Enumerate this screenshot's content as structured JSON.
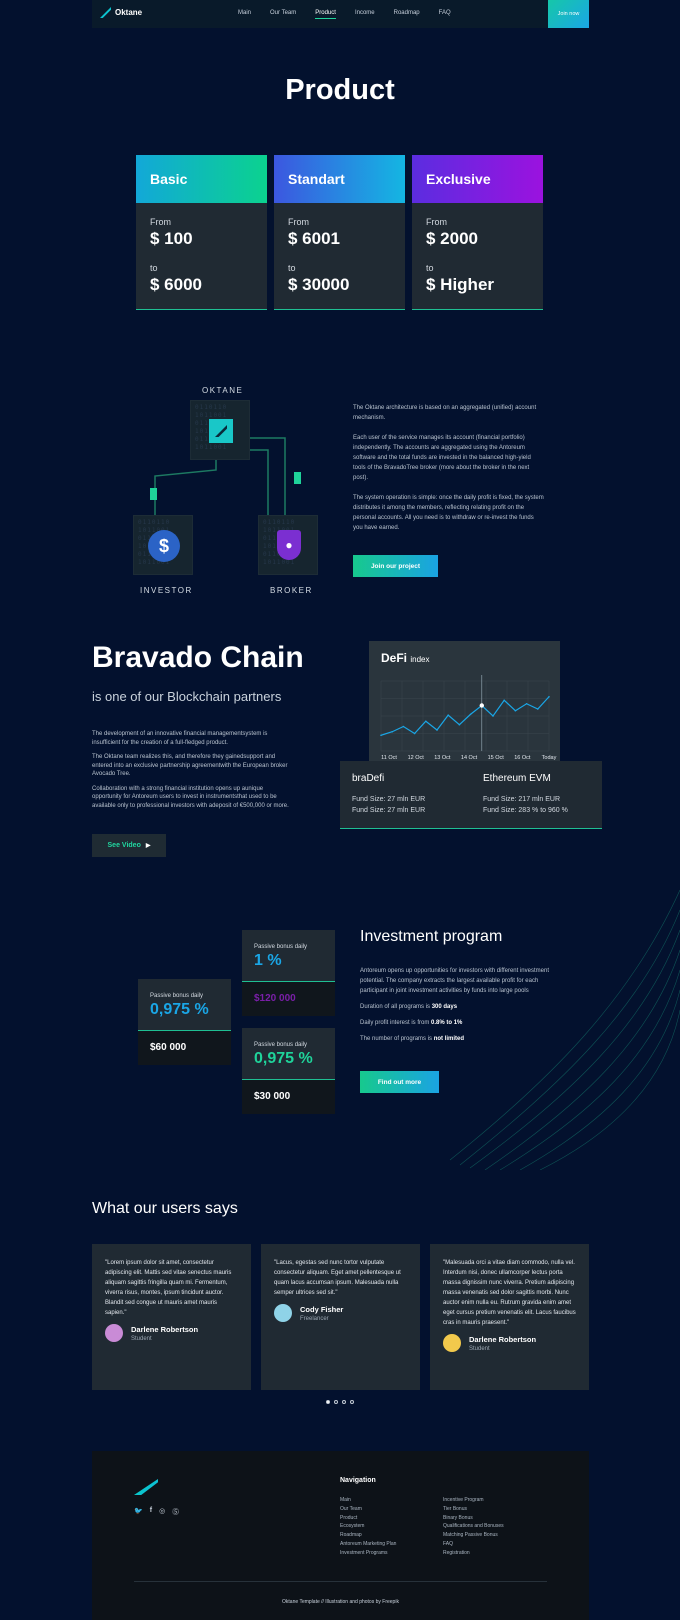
{
  "nav": {
    "brand": "Oktane",
    "links": [
      "Main",
      "Our Team",
      "Product",
      "Income",
      "Roadmap",
      "FAQ"
    ],
    "active": "Product",
    "join_label": "Join now"
  },
  "product": {
    "title": "Product",
    "cards": [
      {
        "name": "Basic",
        "from_label": "From",
        "from_value": "$ 100",
        "to_label": "to",
        "to_value": "$ 6000",
        "color": "#0bc4a0"
      },
      {
        "name": "Standart",
        "from_label": "From",
        "from_value": "$ 6001",
        "to_label": "to",
        "to_value": "$ 30000",
        "color": "#1a93e8"
      },
      {
        "name": "Exclusive",
        "from_label": "From",
        "from_value": "$ 2000",
        "to_label": "to",
        "to_value": "$ Higher",
        "color": "#8b14e0"
      }
    ]
  },
  "architecture": {
    "top_label": "OKTANE",
    "left_label": "INVESTOR",
    "right_label": "BROKER",
    "paragraphs": [
      "The Oktane architecture is based on an aggregated (unified) account mechanism.",
      "Each user of the service manages its account (financial portfolio) independently. The accounts are aggregated using the Antoreum software and the total funds are invested in the balanced high-yield tools of the BravadoTree broker (more about the broker in the next post).",
      "The system operation is simple: once the daily profit is fixed, the system distributes it among the members, reflecting relating profit on the personal accounts. All you need is to withdraw or re-invest the funds you have earned."
    ],
    "button_label": "Join our project"
  },
  "bravado": {
    "title": "Bravado Chain",
    "subtitle": "is one of our Blockchain partners",
    "paragraphs": [
      "The development of an innovative financial managementsystem is insufficient for the creation of a full-fledged product.",
      "The Oktane team realizes this, and therefore they gainedsupport and entered into an exclusive partnership agreementwith the European broker Avocado Tree.",
      "Collaboration with a strong financial institution opens up aunique opportunity for Antoreum users to invest in instrumentsthat used to be available only to professional investors with adeposit of €500,000 or more."
    ],
    "video_label": "See Video",
    "funds": [
      {
        "name": "braDefi",
        "lines": [
          "Fund Size: 27 mln EUR",
          "Fund Size: 27 mln EUR"
        ]
      },
      {
        "name": "Ethereum EVM",
        "lines": [
          "Fund Size: 217 mln EUR",
          "Fund Size: 283 % to 960 %"
        ]
      }
    ]
  },
  "chart_data": {
    "type": "line",
    "title": "DeFi",
    "subtitle": "index",
    "categories": [
      "11 Oct",
      "12 Oct",
      "13 Oct",
      "14 Oct",
      "15 Oct",
      "16 Oct",
      "Today"
    ],
    "series": [
      {
        "values": [
          18,
          22,
          28,
          20,
          34,
          24,
          41,
          30,
          42,
          52,
          40,
          58,
          46,
          54,
          48,
          62
        ],
        "color": "#1aa6e6"
      }
    ],
    "ylim": [
      0,
      80
    ],
    "grid": true
  },
  "investment": {
    "title": "Investment program",
    "intro": "Antoreum opens up opportunities for investors with different investment potential. The company extracts the largest available profit for each participant in joint investment activities by funds into large pools",
    "facts": [
      {
        "text": "Duration of all programs is ",
        "bold": "300 days"
      },
      {
        "text": "Daily profit interest is from ",
        "bold": "0.8% to 1%"
      },
      {
        "text": "The number of programs is ",
        "bold": "not limited"
      }
    ],
    "button_label": "Find out more",
    "cards": [
      {
        "label": "Passive bonus daily",
        "value": "0,975 %",
        "amount": "$60 000",
        "value_color": "#1aa6e6",
        "amount_color": "#ffffff"
      },
      {
        "label": "Passive bonus daily",
        "value": "1 %",
        "amount": "$120 000",
        "value_color": "#1aa6e6",
        "amount_color": "#7a1fa8"
      },
      {
        "label": "Passive bonus daily",
        "value": "0,975 %",
        "amount": "$30 000",
        "value_color": "#1fd39a",
        "amount_color": "#ffffff"
      }
    ]
  },
  "testimonials": {
    "title": "What our users says",
    "items": [
      {
        "quote": "\"Lorem ipsum dolor sit amet, consectetur adipiscing elit. Mattis sed vitae senectus mauris aliquam sagittis fringilla quam mi. Fermentum, viverra risus, montes, ipsum tincidunt auctor. Blandit sed congue ut mauris amet mauris sapien.\"",
        "name": "Darlene Robertson",
        "role": "Student",
        "avatar": "#c98bd6"
      },
      {
        "quote": "\"Lacus, egestas sed nunc tortor vulputate consectetur aliquam. Eget amet pellentesque ut quam lacus accumsan ipsum. Malesuada nulla semper ultrices sed sit.\"",
        "name": "Cody Fisher",
        "role": "Freelancer",
        "avatar": "#8fd3e8"
      },
      {
        "quote": "\"Malesuada orci a vitae diam commodo, nulla vel. Interdum nisi, donec ullamcorper lectus porta massa dignissim nunc viverra. Pretium adipiscing massa venenatis sed dolor sagittis morbi. Nunc auctor enim nulla eu. Rutrum gravida enim amet eget cursus pretium venenatis elit. Lacus faucibus cras in mauris praesent.\"",
        "name": "Darlene Robertson",
        "role": "Student",
        "avatar": "#f2c94c"
      }
    ]
  },
  "footer": {
    "nav_title": "Navigation",
    "col1": [
      "Main",
      "Our Team",
      "Product",
      "Ecosystem",
      "Roadmap",
      "Antoreum Marketing Plan",
      "Investment Programs"
    ],
    "col2": [
      "Incentive Program",
      "Tier Bonus",
      "Binary Bonus",
      "Qualifications and Bonuses",
      "Matching Passive Bonus",
      "FAQ",
      "Registration"
    ],
    "social": [
      "twitter-icon",
      "facebook-icon",
      "instagram-icon",
      "pinterest-icon"
    ],
    "copyright": "Oktane Template // Illustration and photos by Freepik"
  }
}
